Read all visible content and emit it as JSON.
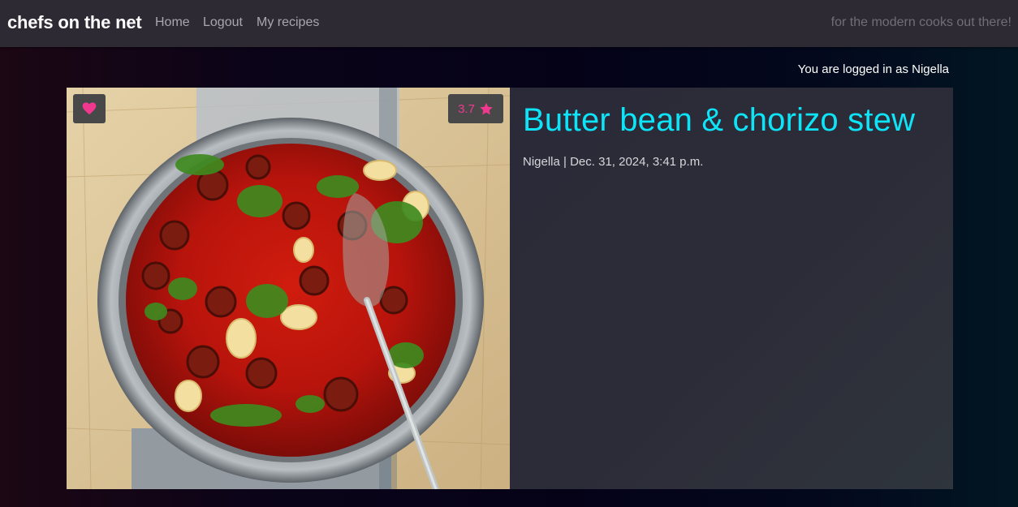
{
  "navbar": {
    "brand": "chefs on the net",
    "links": [
      {
        "label": "Home"
      },
      {
        "label": "Logout"
      },
      {
        "label": "My recipes"
      }
    ],
    "tagline": "for the modern cooks out there!"
  },
  "user_status": "You are logged in as Nigella",
  "recipe": {
    "title": "Butter bean & chorizo stew",
    "author": "Nigella",
    "date": "Dec. 31, 2024, 3:41 p.m.",
    "byline": "Nigella | Dec. 31, 2024, 3:41 p.m.",
    "rating": "3.7",
    "image_icon": "stew-pot-photo",
    "favourite_icon": "heart-icon",
    "rating_icon": "star-icon"
  },
  "colors": {
    "title": "#0ee4f7",
    "accent_pink": "#f0388f",
    "navbar": "#2d2a33"
  }
}
